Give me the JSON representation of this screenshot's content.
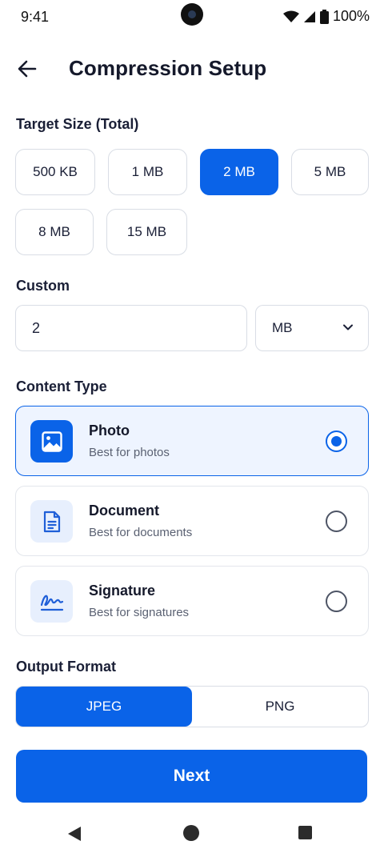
{
  "status_bar": {
    "time": "9:41",
    "battery": "100%",
    "icons": [
      "wifi-icon",
      "signal-icon",
      "battery-icon"
    ]
  },
  "header": {
    "title": "Compression Setup",
    "back_icon": "arrow-left-icon"
  },
  "target_size": {
    "label": "Target Size (Total)",
    "options": [
      "500 KB",
      "1 MB",
      "2 MB",
      "5 MB",
      "8 MB",
      "15 MB"
    ],
    "selected": "2 MB"
  },
  "custom": {
    "label": "Custom",
    "value": "2",
    "unit": "MB"
  },
  "content_type": {
    "label": "Content Type",
    "options": [
      {
        "title": "Photo",
        "subtitle": "Best for photos",
        "icon": "image-icon",
        "selected": true
      },
      {
        "title": "Document",
        "subtitle": "Best for documents",
        "icon": "document-icon",
        "selected": false
      },
      {
        "title": "Signature",
        "subtitle": "Best for signatures",
        "icon": "signature-icon",
        "selected": false
      }
    ]
  },
  "output_format": {
    "label": "Output Format",
    "options": [
      "JPEG",
      "PNG"
    ],
    "selected": "JPEG"
  },
  "actions": {
    "next_label": "Next"
  },
  "colors": {
    "accent": "#0a63e8",
    "selected_card_bg": "#eef4ff",
    "border": "#d9dde5"
  }
}
